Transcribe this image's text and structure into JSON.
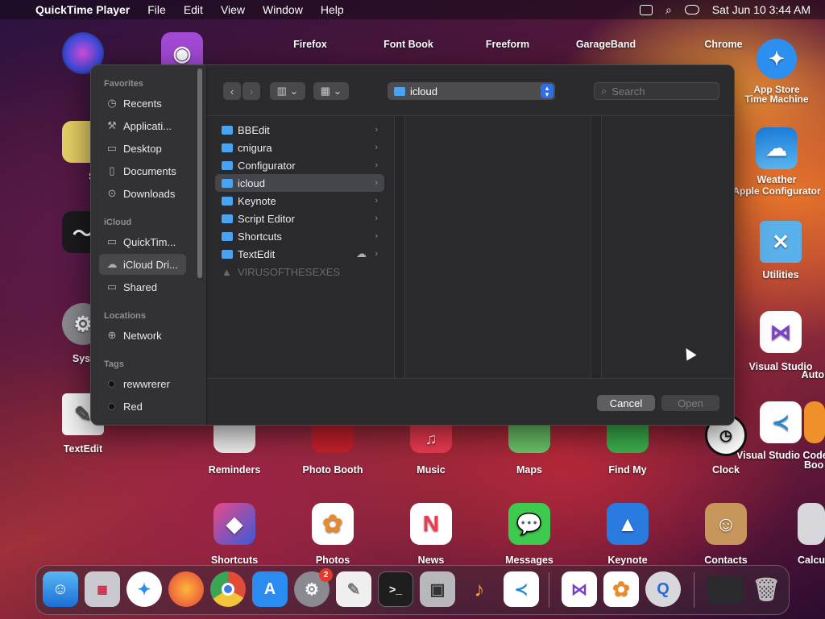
{
  "menubar": {
    "app_name": "QuickTime Player",
    "menus": [
      "File",
      "Edit",
      "View",
      "Window",
      "Help"
    ],
    "datetime": "Sat Jun 10  3:44 AM"
  },
  "desktop_icons": {
    "siri": "Siri",
    "stickies": "Stick",
    "stocks": "Stoc",
    "system_settings": "System S",
    "textedit": "TextEdit",
    "firefox": "Firefox",
    "font_book": "Font Book",
    "freeform": "Freeform",
    "garageband": "GarageBand",
    "chrome": "Chrome",
    "app_store": "App Store",
    "time_machine": "Time Machine",
    "safari": "Safari",
    "apple_configurator": "Apple Configurator",
    "weather": "Weather",
    "utilities": "Utilities",
    "visual_studio_1": "Visual Studio",
    "automator": "Autor",
    "visual_studio_code": "Visual Studio Code",
    "books": "Boo",
    "reminders": "Reminders",
    "photo_booth": "Photo Booth",
    "music": "Music",
    "maps": "Maps",
    "find_my": "Find My",
    "clock": "Clock",
    "chess": "s",
    "shortcuts": "Shortcuts",
    "photos": "Photos",
    "news": "News",
    "messages": "Messages",
    "keynote": "Keynote",
    "contacts": "Contacts",
    "calculator": "Calcu"
  },
  "dialog": {
    "sidebar": {
      "favorites_header": "Favorites",
      "favorites": [
        "Recents",
        "Applicati...",
        "Desktop",
        "Documents",
        "Downloads"
      ],
      "icloud_header": "iCloud",
      "icloud": [
        "QuickTim...",
        "iCloud Dri...",
        "Shared"
      ],
      "locations_header": "Locations",
      "locations": [
        "Network"
      ],
      "tags_header": "Tags",
      "tags": [
        "rewwrerer",
        "Red"
      ]
    },
    "path_selector": "icloud",
    "search_placeholder": "Search",
    "files": [
      {
        "name": "BBEdit"
      },
      {
        "name": "cnigura"
      },
      {
        "name": "Configurator"
      },
      {
        "name": "icloud"
      },
      {
        "name": "Keynote"
      },
      {
        "name": "Script Editor"
      },
      {
        "name": "Shortcuts"
      },
      {
        "name": "TextEdit"
      },
      {
        "name": "VIRUSOFTHESEXES"
      }
    ],
    "cancel_label": "Cancel",
    "open_label": "Open"
  },
  "dock": {
    "settings_badge": "2"
  }
}
